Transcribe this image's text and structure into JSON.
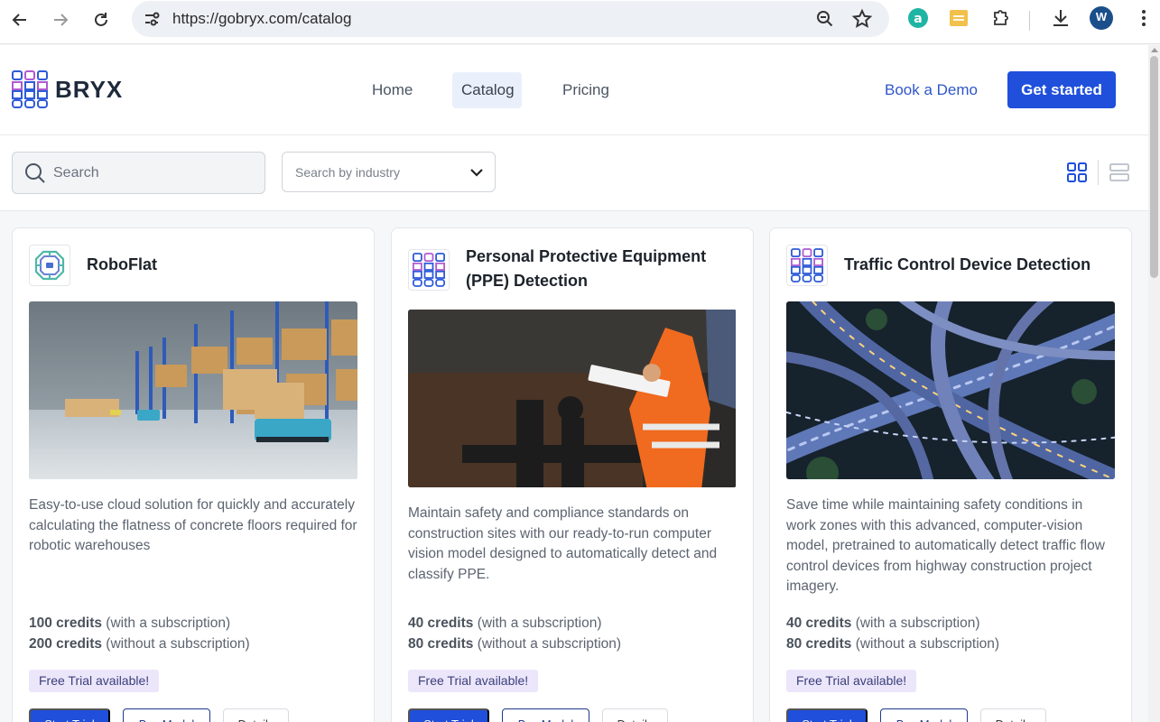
{
  "browser": {
    "url": "https://gobryx.com/catalog",
    "profile_initial": "W",
    "icons": [
      "back-arrow-icon",
      "forward-arrow-icon",
      "reload-icon",
      "site-settings-icon",
      "zoom-icon",
      "star-icon",
      "extension-a-icon",
      "extension-sheet-icon",
      "puzzle-icon",
      "download-icon",
      "kebab-menu-icon"
    ]
  },
  "header": {
    "logo_text": "BRYX",
    "nav": [
      {
        "label": "Home",
        "active": false
      },
      {
        "label": "Catalog",
        "active": true
      },
      {
        "label": "Pricing",
        "active": false
      }
    ],
    "book_demo": "Book a Demo",
    "get_started": "Get started"
  },
  "filters": {
    "search_placeholder": "Search",
    "industry_placeholder": "Search by industry",
    "view_modes": [
      "grid-view-icon",
      "list-view-icon"
    ]
  },
  "cards": [
    {
      "title_lines": [
        "RoboFlat"
      ],
      "description": "Easy-to-use cloud solution for quickly and accurately calculating the flatness of concrete floors required for robotic warehouses",
      "credits_with_value": "100 credits",
      "credits_with_suffix": " (with a subscription)",
      "credits_without_value": "200 credits",
      "credits_without_suffix": " (without a subscription)",
      "badge": "Free Trial available!",
      "btn_primary": "Start Trial",
      "btn_outline": "Buy Model",
      "btn_ghost": "Details",
      "image": "warehouse-robot-image"
    },
    {
      "title_lines": [
        "Personal Protective Equipment",
        "(PPE) Detection"
      ],
      "description": "Maintain safety and compliance standards on construction sites with our ready-to-run computer vision model designed to automatically detect and classify PPE.",
      "credits_with_value": "40 credits",
      "credits_with_suffix": " (with a subscription)",
      "credits_without_value": "80 credits",
      "credits_without_suffix": " (without a subscription)",
      "badge": "Free Trial available!",
      "btn_primary": "Start Trial",
      "btn_outline": "Buy Model",
      "btn_ghost": "Details",
      "image": "construction-worker-image"
    },
    {
      "title_lines": [
        "Traffic Control Device Detection"
      ],
      "description": "Save time while maintaining safety conditions in work zones with this advanced, computer-vision model, pretrained to automatically detect traffic flow control devices from highway construction project imagery.",
      "credits_with_value": "40 credits",
      "credits_with_suffix": " (with a subscription)",
      "credits_without_value": "80 credits",
      "credits_without_suffix": " (without a subscription)",
      "badge": "Free Trial available!",
      "btn_primary": "Start Trial",
      "btn_outline": "Buy Model",
      "btn_ghost": "Details",
      "image": "highway-interchange-image"
    }
  ],
  "colors": {
    "accent": "#1f4fdb",
    "link": "#2f56c9",
    "badge_bg": "#ece6fb"
  }
}
